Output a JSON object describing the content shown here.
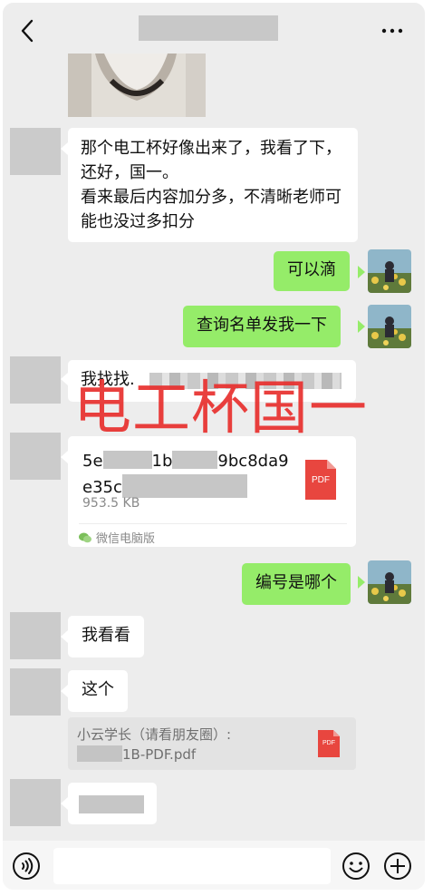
{
  "header": {
    "back_icon": "chevron-left-icon",
    "more_icon": "more-dots-icon"
  },
  "messages": {
    "m1": "那个电工杯好像出来了，我看了下，还好，国一。",
    "m1_line2": "看来最后内容加分多，不清晰老师可能也没过多扣分",
    "m2": "可以滴",
    "m3": "查询名单发我一下",
    "m4": "我找找.",
    "m5": "编号是哪个",
    "m6": "我看看",
    "m7": "这个"
  },
  "file1": {
    "name_part1": "5e",
    "name_part2": "1b",
    "name_part3": "9bc8da9",
    "name_line2": "e35c",
    "size": "953.5 KB",
    "source": "微信电脑版",
    "type_label": "PDF"
  },
  "file2": {
    "title": "小云学长（请看朋友圈）:",
    "name": "1B-PDF.pdf",
    "type_label": "PDF"
  },
  "watermark": "电工杯国一",
  "colors": {
    "accent_green": "#95ec69",
    "pdf_red": "#e8463f",
    "watermark_red": "#e8302e"
  }
}
